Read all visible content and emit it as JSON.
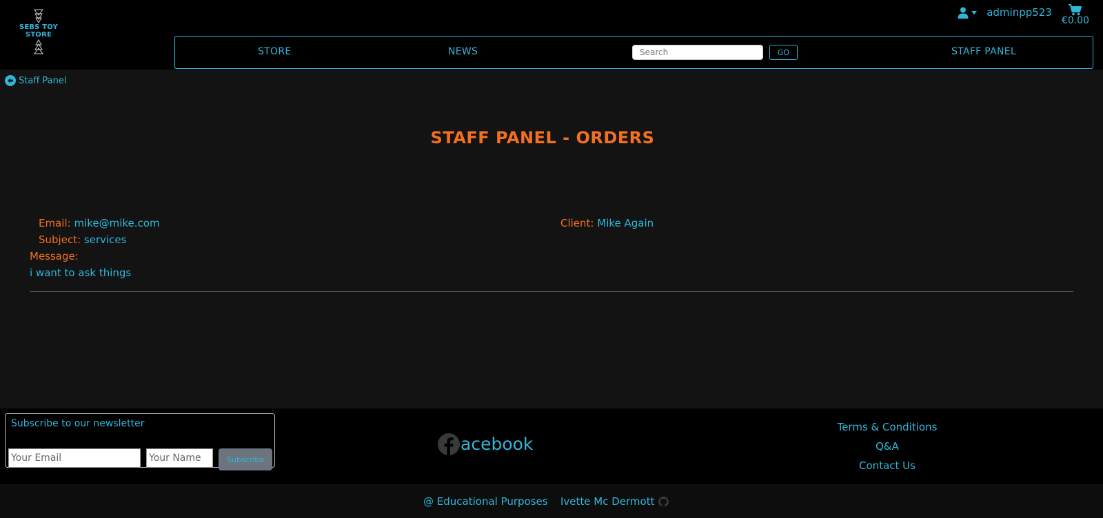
{
  "header": {
    "logo_text_line1": "SEBS TOY",
    "logo_text_line2": "STORE",
    "user_icon": "user-icon",
    "username": "adminpp523",
    "cart_icon": "cart-icon",
    "cart_total": "€0.00"
  },
  "nav": {
    "store": "STORE",
    "news": "NEWS",
    "search_placeholder": "Search",
    "go": "GO",
    "staff_panel": "STAFF PANEL"
  },
  "main": {
    "back_icon": "arrow-left-circle-icon",
    "back_label": "Staff Panel",
    "title": "STAFF PANEL - ORDERS",
    "message": {
      "email_label": "Email:",
      "email": "mike@mike.com",
      "client_label": "Client:",
      "client": "Mike Again",
      "subject_label": "Subject:",
      "subject": "services",
      "message_label": "Message:",
      "message": "i want to ask things"
    }
  },
  "footer": {
    "newsletter_title": "Subscribe to our newsletter",
    "email_placeholder": "Your Email",
    "name_placeholder": "Your Name",
    "subscribe": "Subscribe",
    "facebook_icon": "facebook-icon",
    "facebook_text": "acebook",
    "links": [
      "Terms & Conditions",
      "Q&A",
      "Contact Us"
    ],
    "copyright": "@ Educational Purposes",
    "author": "Ivette Mc Dermott",
    "github_icon": "github-icon"
  },
  "colors": {
    "accent": "#2fb7d9",
    "label": "#f36f21",
    "background": "#131313",
    "header_bg": "#000000"
  }
}
